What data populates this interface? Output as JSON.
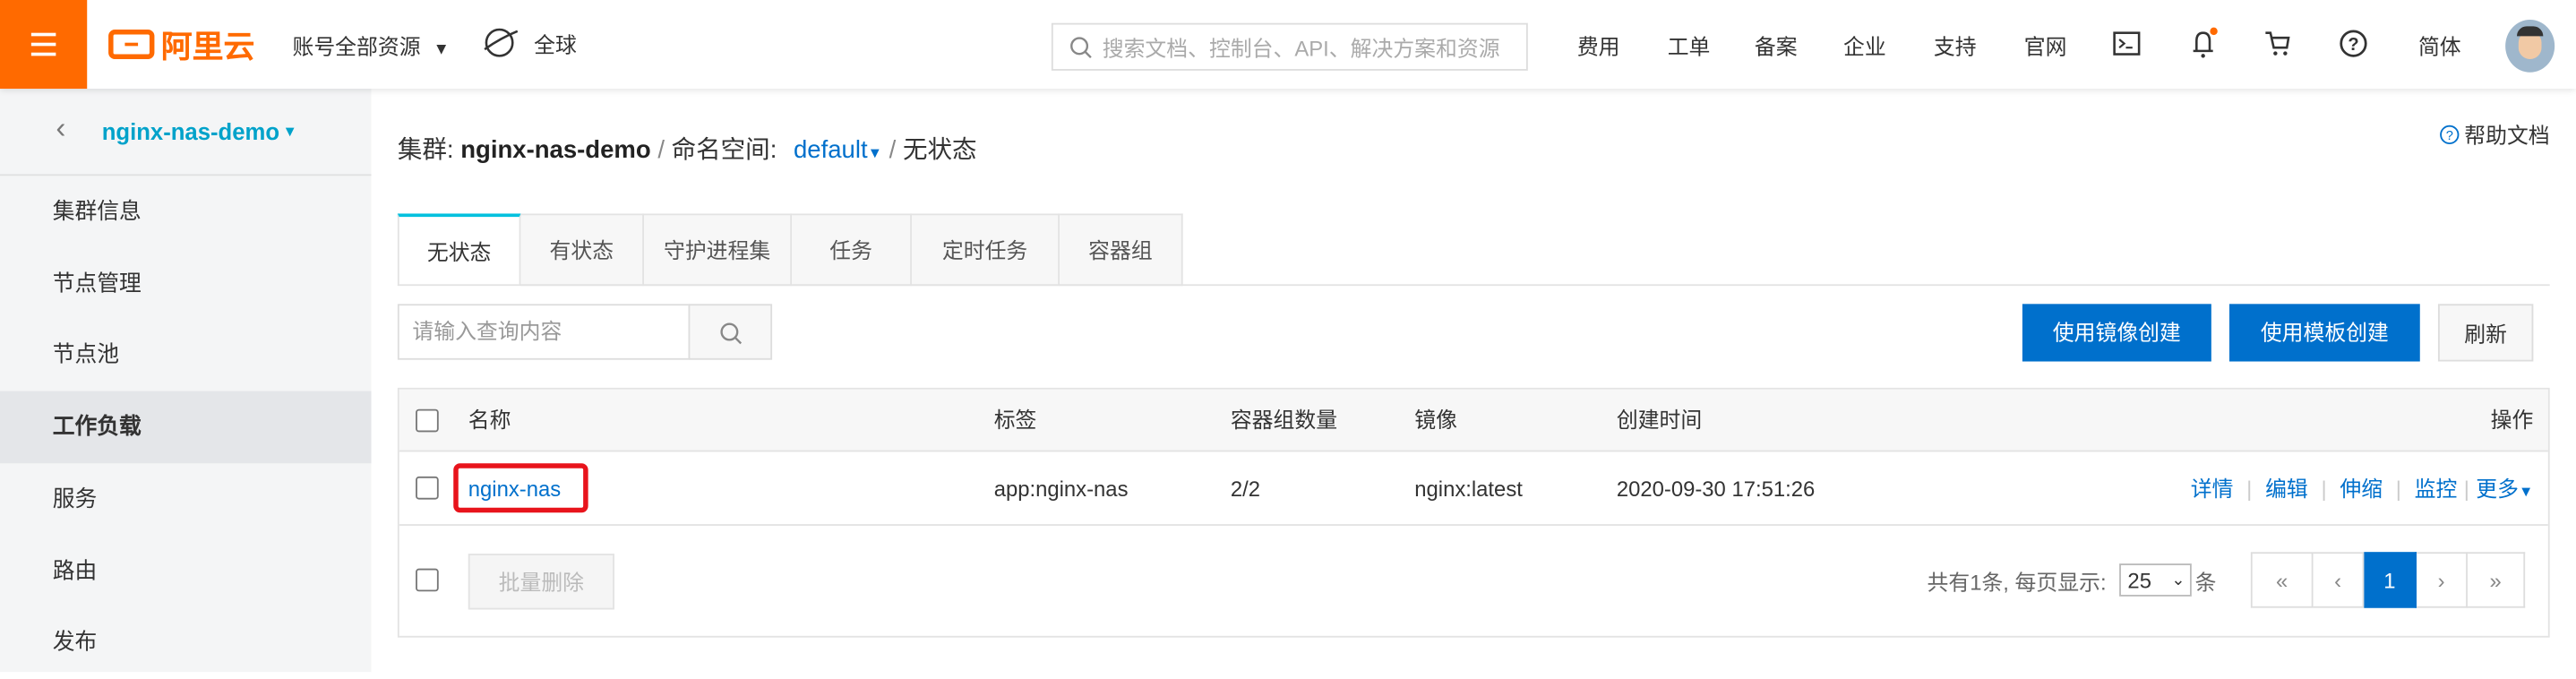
{
  "topbar": {
    "brand": "阿里云",
    "account_menu": "账号全部资源",
    "region": "全球",
    "search_placeholder": "搜索文档、控制台、API、解决方案和资源",
    "nav": [
      "费用",
      "工单",
      "备案",
      "企业",
      "支持",
      "官网"
    ],
    "language": "简体",
    "accent": "#ff6a00"
  },
  "sidebar": {
    "cluster": "nginx-nas-demo",
    "items": [
      {
        "label": "集群信息"
      },
      {
        "label": "节点管理"
      },
      {
        "label": "节点池"
      },
      {
        "label": "工作负载",
        "active": true
      },
      {
        "label": "服务"
      },
      {
        "label": "路由"
      },
      {
        "label": "发布"
      }
    ]
  },
  "breadcrumb": {
    "cluster_label": "集群:",
    "cluster": "nginx-nas-demo",
    "sep": "/",
    "ns_label": "命名空间:",
    "namespace": "default",
    "current": "无状态"
  },
  "help": "帮助文档",
  "tabs": [
    "无状态",
    "有状态",
    "守护进程集",
    "任务",
    "定时任务",
    "容器组"
  ],
  "toolbar": {
    "search_placeholder": "请输入查询内容",
    "create_image": "使用镜像创建",
    "create_template": "使用模板创建",
    "refresh": "刷新",
    "primary_color": "#0070cc"
  },
  "table": {
    "columns": [
      "名称",
      "标签",
      "容器组数量",
      "镜像",
      "创建时间",
      "操作"
    ],
    "rows": [
      {
        "name": "nginx-nas",
        "label": "app:nginx-nas",
        "pods": "2/2",
        "image": "nginx:latest",
        "created": "2020-09-30 17:51:26",
        "actions": [
          "详情",
          "编辑",
          "伸缩",
          "监控",
          "更多"
        ]
      }
    ],
    "batch_delete": "批量删除",
    "total_text": "共有1条, 每页显示:",
    "page_size": "25",
    "unit": "条",
    "pager": [
      "«",
      "‹",
      "1",
      "›",
      "»"
    ]
  }
}
